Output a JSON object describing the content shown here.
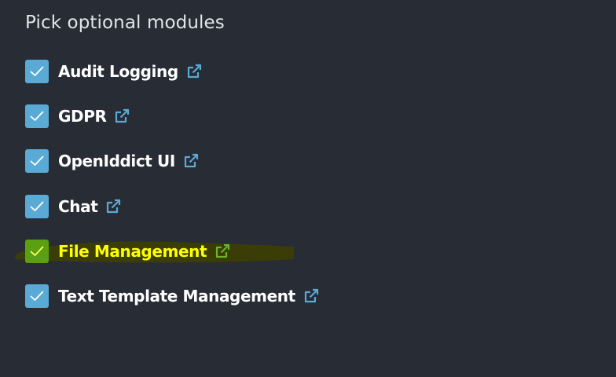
{
  "header": {
    "title": "Pick optional modules"
  },
  "colors": {
    "background": "#282c35",
    "checkbox": "#5aaad6",
    "link_icon": "#5aaad6",
    "highlight_stroke": "#3a3d06",
    "highlight_text": "#ffff00",
    "highlight_checkbox": "#5aa012",
    "highlight_icon": "#6ab52a"
  },
  "modules": [
    {
      "label": "Audit Logging",
      "checked": true,
      "highlighted": false,
      "icon": "external-link-icon"
    },
    {
      "label": "GDPR",
      "checked": true,
      "highlighted": false,
      "icon": "external-link-icon"
    },
    {
      "label": "OpenIddict UI",
      "checked": true,
      "highlighted": false,
      "icon": "external-link-icon"
    },
    {
      "label": "Chat",
      "checked": true,
      "highlighted": false,
      "icon": "external-link-icon"
    },
    {
      "label": "File Management",
      "checked": true,
      "highlighted": true,
      "icon": "external-link-icon"
    },
    {
      "label": "Text Template Management",
      "checked": true,
      "highlighted": false,
      "icon": "external-link-icon"
    }
  ]
}
